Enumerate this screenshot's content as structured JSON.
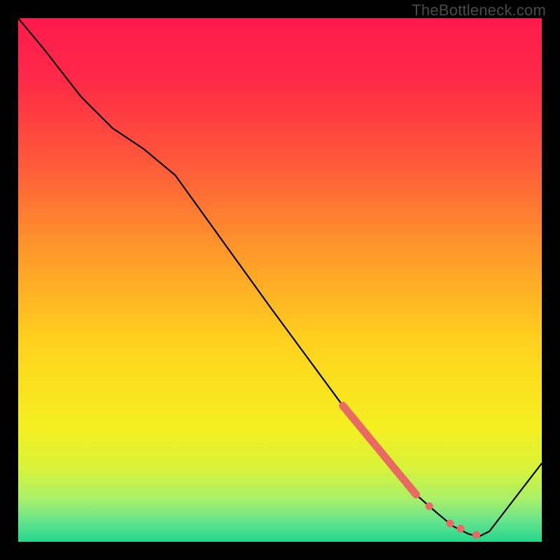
{
  "watermark": "TheBottleneck.com",
  "chart_data": {
    "type": "line",
    "title": "",
    "xlabel": "",
    "ylabel": "",
    "xlim": [
      0,
      100
    ],
    "ylim": [
      0,
      100
    ],
    "grid": false,
    "series": [
      {
        "name": "curve",
        "x": [
          0,
          5,
          12,
          18,
          24,
          30,
          48,
          62,
          70,
          76,
          80,
          83,
          86,
          88,
          90,
          100
        ],
        "y": [
          100,
          94,
          85,
          79,
          75,
          70,
          45,
          26,
          16,
          9,
          5.5,
          3,
          1.5,
          1,
          2,
          15
        ]
      }
    ],
    "highlights": [
      {
        "name": "segment",
        "kind": "thick-line",
        "x": [
          62,
          76
        ],
        "y": [
          26,
          9
        ]
      },
      {
        "name": "dot-1",
        "kind": "dot",
        "x": 78.5,
        "y": 6.8
      },
      {
        "name": "dot-2",
        "kind": "dot",
        "x": 82.5,
        "y": 3.5
      },
      {
        "name": "dot-3",
        "kind": "dot",
        "x": 84.5,
        "y": 2.5
      },
      {
        "name": "dot-4",
        "kind": "dot",
        "x": 87.5,
        "y": 1.3
      }
    ],
    "background_gradient": {
      "stops": [
        {
          "offset": 0.0,
          "color": "#ff1a4d"
        },
        {
          "offset": 0.12,
          "color": "#ff2a47"
        },
        {
          "offset": 0.28,
          "color": "#ff5a3a"
        },
        {
          "offset": 0.45,
          "color": "#ff9a2a"
        },
        {
          "offset": 0.62,
          "color": "#ffd21e"
        },
        {
          "offset": 0.78,
          "color": "#f5ef20"
        },
        {
          "offset": 0.86,
          "color": "#d7f33a"
        },
        {
          "offset": 0.92,
          "color": "#a8f06a"
        },
        {
          "offset": 0.965,
          "color": "#5ee28f"
        },
        {
          "offset": 1.0,
          "color": "#22d68b"
        }
      ]
    },
    "colors": {
      "curve": "#000000",
      "highlight": "#e86a63"
    }
  }
}
